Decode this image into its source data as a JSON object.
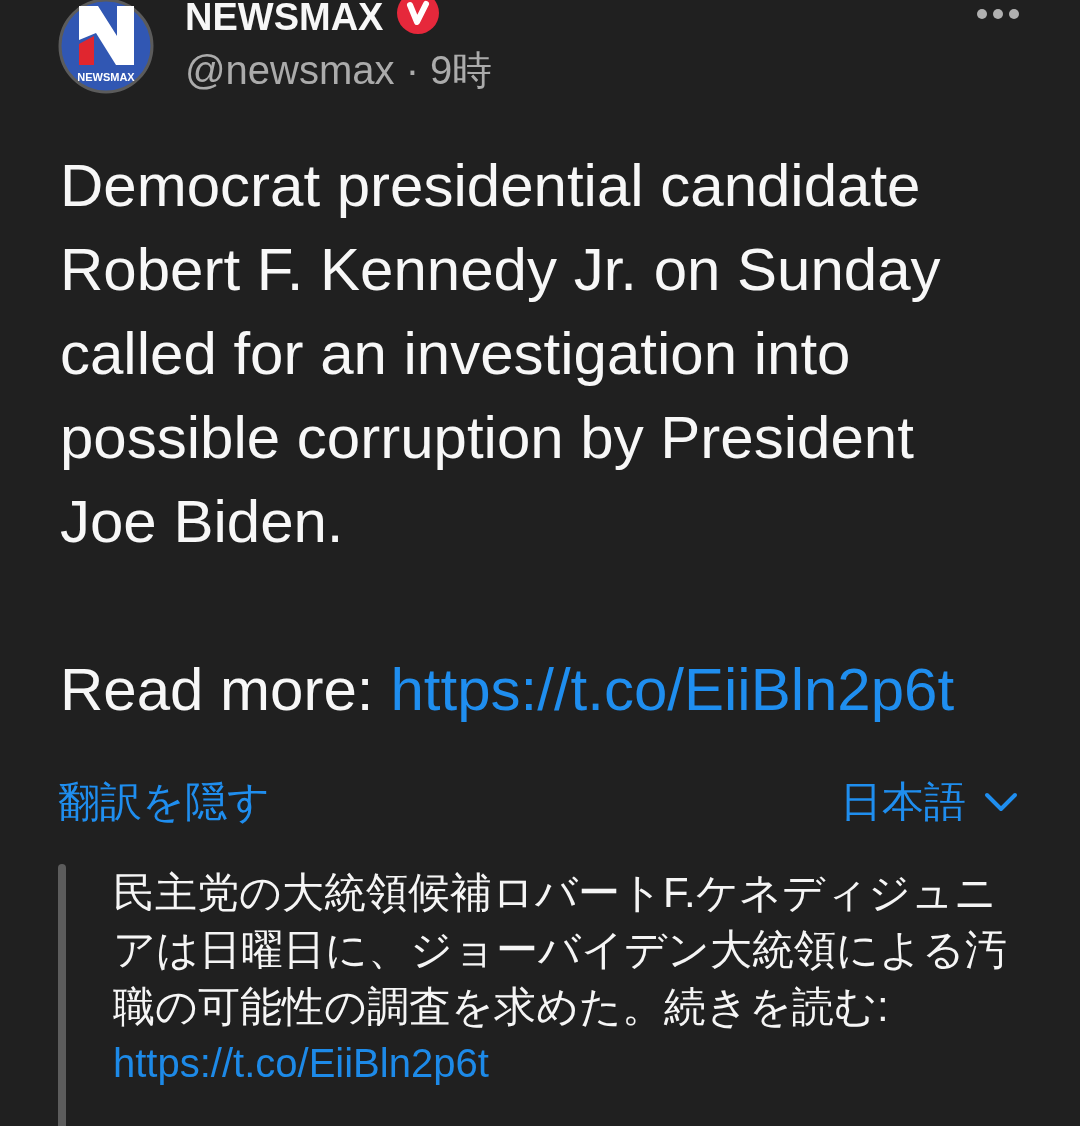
{
  "author": {
    "logo_text": "NEWSMAX",
    "name": "NEWSMAX",
    "verified": true,
    "meta": "@newsmax · 9時"
  },
  "tweet": {
    "text": "Democrat presidential candidate Robert F. Kennedy Jr. on Sunday called for an investigation into possible corruption by President Joe Biden.",
    "read_more_label": "Read more:",
    "link": "https://t.co/EiiBln2p6t"
  },
  "translation": {
    "toggle": "翻訳を隠す",
    "language": "日本語",
    "text": "民主党の大統領候補ロバートF.ケネディジュニアは日曜日に、ジョーバイデン大統領による汚職の可能性の調査を求めた。続きを読む:",
    "link": "https://t.co/EiiBln2p6t"
  }
}
